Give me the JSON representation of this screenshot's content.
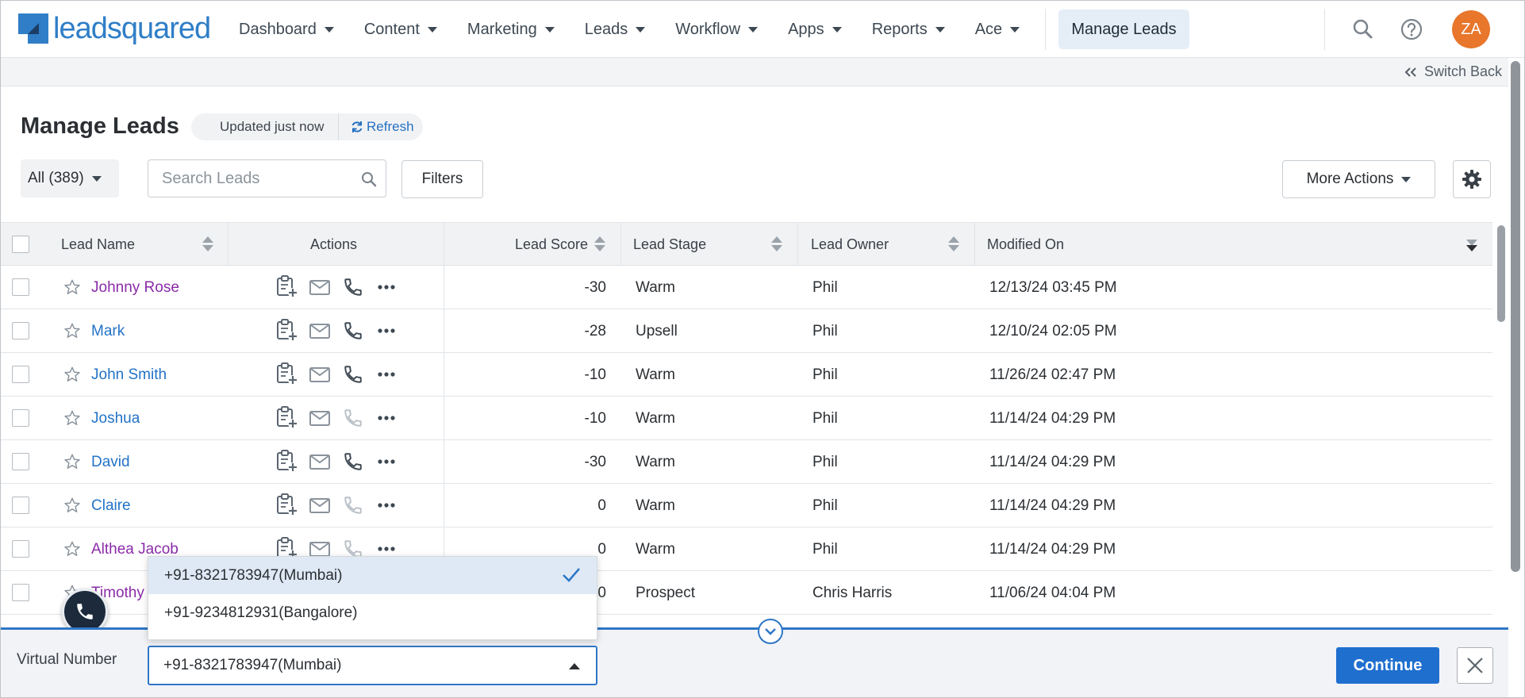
{
  "brand": {
    "name": "leadsquared",
    "color": "#2f7ec7"
  },
  "nav": {
    "items": [
      {
        "label": "Dashboard"
      },
      {
        "label": "Content"
      },
      {
        "label": "Marketing"
      },
      {
        "label": "Leads"
      },
      {
        "label": "Workflow"
      },
      {
        "label": "Apps"
      },
      {
        "label": "Reports"
      },
      {
        "label": "Ace"
      }
    ],
    "active_page": "Manage Leads",
    "icons": [
      "search-icon",
      "help-icon"
    ],
    "avatar_initials": "ZA",
    "avatar_color": "#e8762b"
  },
  "switch_back": {
    "label": "Switch Back"
  },
  "page": {
    "title": "Manage Leads",
    "updated": "Updated just now",
    "refresh": "Refresh"
  },
  "toolbar": {
    "all_filter": "All (389)",
    "search_placeholder": "Search Leads",
    "filters_label": "Filters",
    "more_actions_label": "More Actions"
  },
  "table": {
    "columns": {
      "lead_name": "Lead Name",
      "actions": "Actions",
      "lead_score": "Lead Score",
      "lead_stage": "Lead Stage",
      "lead_owner": "Lead Owner",
      "modified_on": "Modified On"
    },
    "rows": [
      {
        "name": "Johnny Rose",
        "visited": true,
        "score": "-30",
        "stage": "Warm",
        "owner": "Phil",
        "modified": "12/13/24 03:45 PM",
        "phone_enabled": true
      },
      {
        "name": "Mark",
        "visited": false,
        "score": "-28",
        "stage": "Upsell",
        "owner": "Phil",
        "modified": "12/10/24 02:05 PM",
        "phone_enabled": true
      },
      {
        "name": "John Smith",
        "visited": false,
        "score": "-10",
        "stage": "Warm",
        "owner": "Phil",
        "modified": "11/26/24 02:47 PM",
        "phone_enabled": true
      },
      {
        "name": "Joshua",
        "visited": false,
        "score": "-10",
        "stage": "Warm",
        "owner": "Phil",
        "modified": "11/14/24 04:29 PM",
        "phone_enabled": false
      },
      {
        "name": "David",
        "visited": false,
        "score": "-30",
        "stage": "Warm",
        "owner": "Phil",
        "modified": "11/14/24 04:29 PM",
        "phone_enabled": true
      },
      {
        "name": "Claire",
        "visited": false,
        "score": "0",
        "stage": "Warm",
        "owner": "Phil",
        "modified": "11/14/24 04:29 PM",
        "phone_enabled": false
      },
      {
        "name": "Althea Jacob",
        "visited": true,
        "score": "0",
        "stage": "Warm",
        "owner": "Phil",
        "modified": "11/14/24 04:29 PM",
        "phone_enabled": false
      },
      {
        "name": "Timothy",
        "visited": true,
        "score": "0",
        "stage": "Prospect",
        "owner": "Chris Harris",
        "modified": "11/06/24 04:04 PM",
        "phone_enabled": false
      }
    ]
  },
  "virtual_number": {
    "label": "Virtual Number",
    "selected": "+91-8321783947(Mumbai)",
    "options": [
      {
        "label": "+91-8321783947(Mumbai)",
        "selected": true
      },
      {
        "label": "+91-9234812931(Bangalore)",
        "selected": false
      }
    ],
    "continue_label": "Continue"
  },
  "colors": {
    "accent": "#1f6fcf",
    "link": "#2373c7",
    "visited_link": "#8a2ba8"
  }
}
